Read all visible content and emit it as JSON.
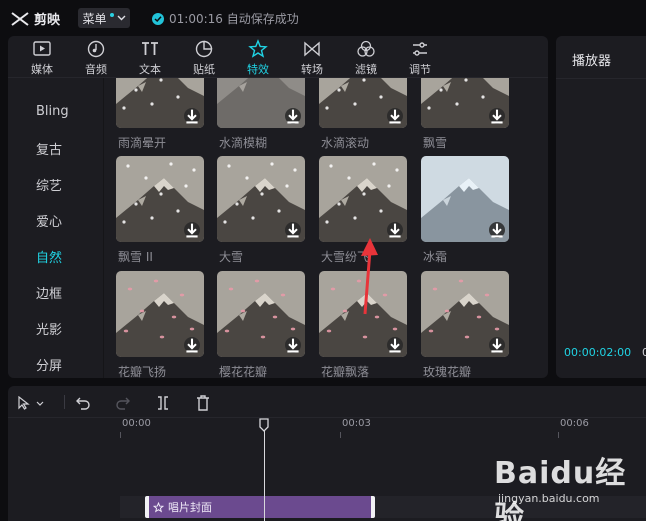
{
  "app": {
    "name": "剪映",
    "menu_label": "菜单",
    "save_status": "01:00:16 自动保存成功"
  },
  "toolbar": {
    "tabs": [
      {
        "label": "媒体",
        "icon": "media-icon"
      },
      {
        "label": "音频",
        "icon": "audio-icon"
      },
      {
        "label": "文本",
        "icon": "text-icon"
      },
      {
        "label": "贴纸",
        "icon": "sticker-icon"
      },
      {
        "label": "特效",
        "icon": "effects-icon",
        "active": true
      },
      {
        "label": "转场",
        "icon": "transition-icon"
      },
      {
        "label": "滤镜",
        "icon": "filter-icon"
      },
      {
        "label": "调节",
        "icon": "adjust-icon"
      }
    ]
  },
  "categories": {
    "items": [
      {
        "label": "Bling"
      },
      {
        "label": "复古"
      },
      {
        "label": "综艺"
      },
      {
        "label": "爱心"
      },
      {
        "label": "自然",
        "active": true
      },
      {
        "label": "边框"
      },
      {
        "label": "光影"
      },
      {
        "label": "分屏"
      }
    ]
  },
  "effects": {
    "row1": [
      "雨滴晕开",
      "水滴模糊",
      "水滴滚动",
      "飘雪"
    ],
    "row2": [
      "飘雪 II",
      "大雪",
      "大雪纷飞",
      "冰霜"
    ],
    "row3": [
      "花瓣飞扬",
      "樱花花瓣",
      "花瓣飘落",
      "玫瑰花瓣"
    ]
  },
  "player": {
    "title": "播放器",
    "current_time": "00:00:02:00",
    "total_time_fragment": "0"
  },
  "timeline": {
    "ticks": [
      "00:00",
      "00:03",
      "00:06"
    ],
    "clip_label": "唱片封面"
  },
  "watermark": {
    "text": "Baidu经验",
    "url": "jingyan.baidu.com"
  },
  "colors": {
    "accent": "#20d3e4",
    "clip": "#6b4a8f",
    "annotation": "#e8343a"
  }
}
